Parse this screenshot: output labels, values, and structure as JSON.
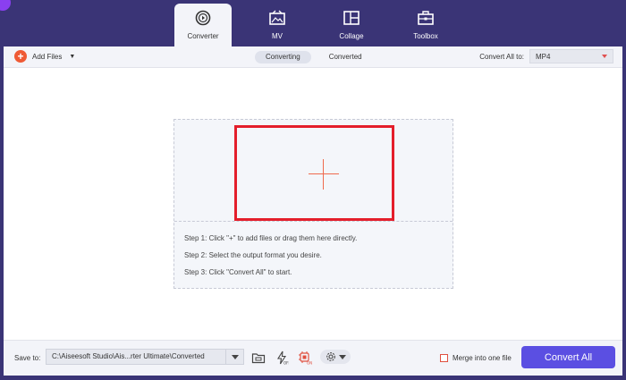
{
  "nav": {
    "tabs": [
      {
        "label": "Converter",
        "icon": "converter-icon",
        "active": true
      },
      {
        "label": "MV",
        "icon": "mv-icon",
        "active": false
      },
      {
        "label": "Collage",
        "icon": "collage-icon",
        "active": false
      },
      {
        "label": "Toolbox",
        "icon": "toolbox-icon",
        "active": false
      }
    ]
  },
  "toolbar": {
    "add_files": "Add Files",
    "status_tabs": [
      {
        "label": "Converting",
        "active": true
      },
      {
        "label": "Converted",
        "active": false
      }
    ],
    "convert_all_to_label": "Convert All to:",
    "format_value": "MP4"
  },
  "dropzone": {
    "steps": [
      "Step 1: Click \"+\" to add files or drag them here directly.",
      "Step 2: Select the output format you desire.",
      "Step 3: Click \"Convert All\" to start."
    ]
  },
  "bottom": {
    "save_to_label": "Save to:",
    "save_path": "C:\\Aiseesoft Studio\\Ais...rter Ultimate\\Converted",
    "merge_label": "Merge into one file",
    "convert_all_label": "Convert All"
  },
  "colors": {
    "frame": "#3a3476",
    "accent_button": "#5b4fe2",
    "add_icon": "#ef5a35",
    "highlight_border": "#e41e2b"
  }
}
